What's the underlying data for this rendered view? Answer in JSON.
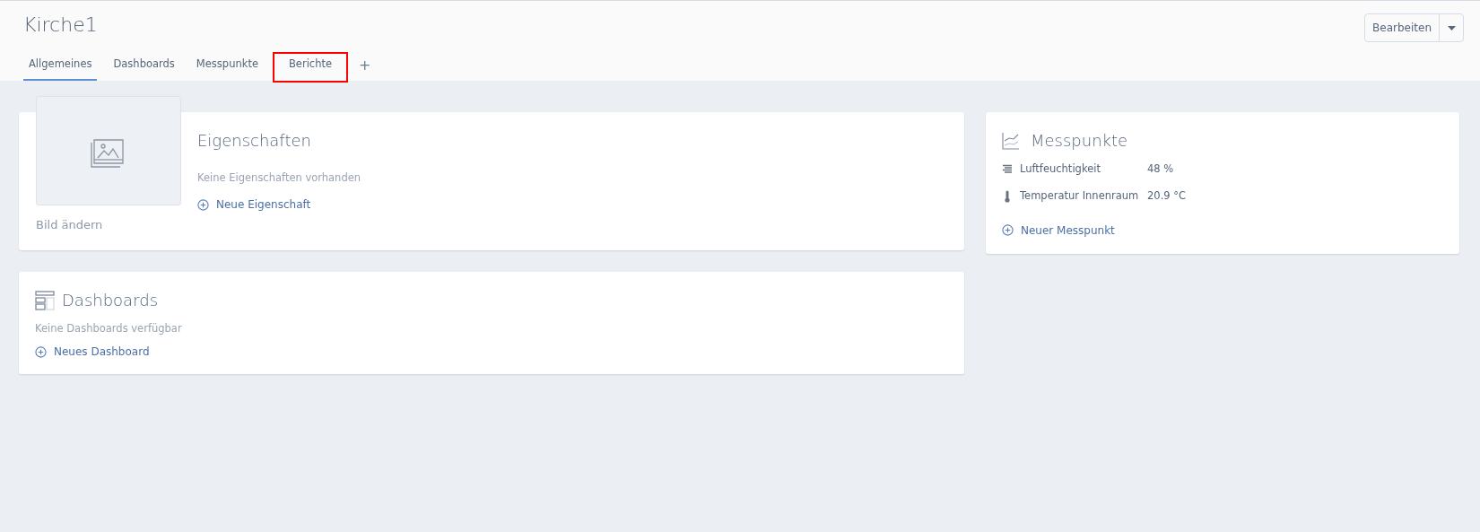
{
  "header": {
    "title": "Kirche1",
    "edit_button": "Bearbeiten"
  },
  "tabs": [
    {
      "label": "Allgemeines",
      "selected": true,
      "highlighted": false
    },
    {
      "label": "Dashboards",
      "selected": false,
      "highlighted": false
    },
    {
      "label": "Messpunkte",
      "selected": false,
      "highlighted": false
    },
    {
      "label": "Berichte",
      "selected": false,
      "highlighted": true
    }
  ],
  "add_tab": "+",
  "properties": {
    "image_link": "Bild ändern",
    "title": "Eigenschaften",
    "empty": "Keine Eigenschaften vorhanden",
    "add": "Neue Eigenschaft"
  },
  "dashboards": {
    "title": "Dashboards",
    "empty": "Keine Dashboards verfügbar",
    "add": "Neues Dashboard"
  },
  "measurements": {
    "title": "Messpunkte",
    "items": [
      {
        "kind": "humidity",
        "name": "Luftfeuchtigkeit",
        "value": "48 %"
      },
      {
        "kind": "temperature",
        "name": "Temperatur Innenraum",
        "value": "20.9 °C"
      }
    ],
    "add": "Neuer Messpunkt"
  }
}
